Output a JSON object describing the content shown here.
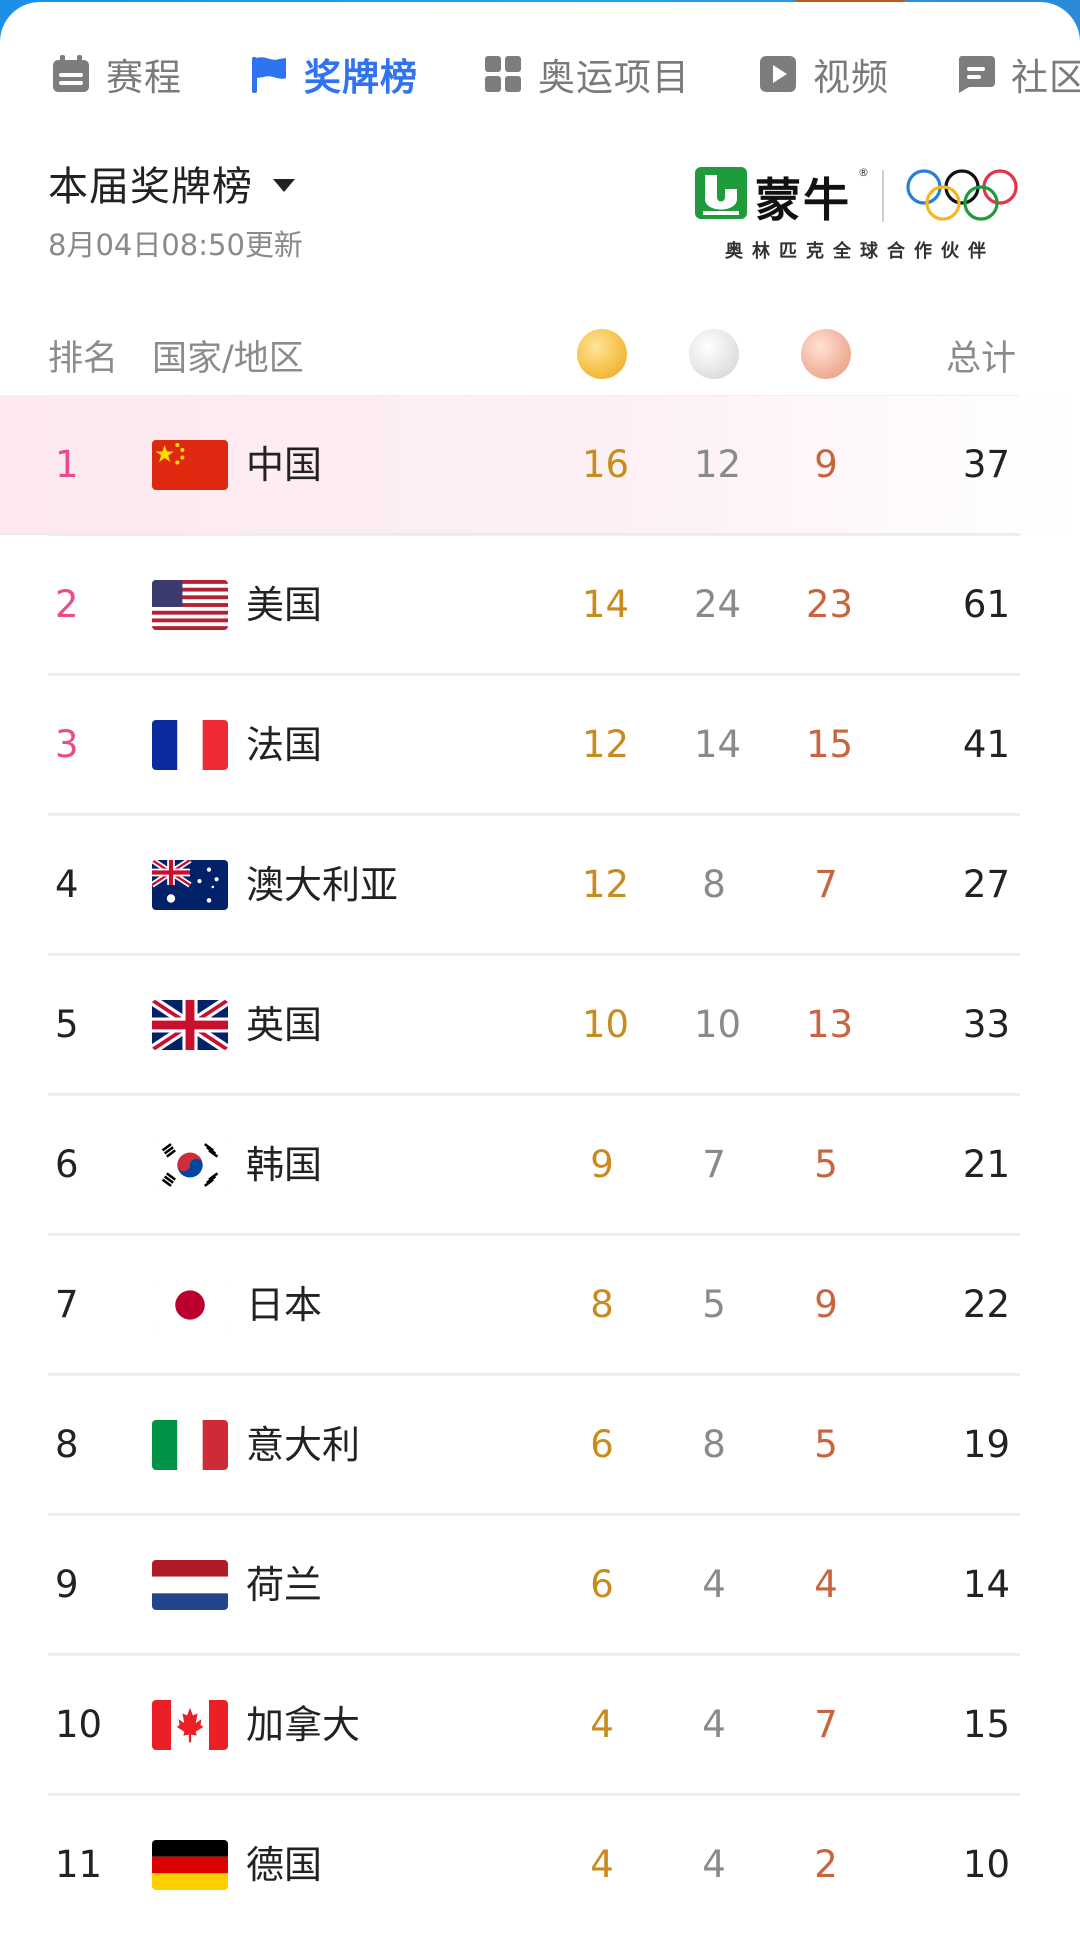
{
  "tabs": [
    {
      "label": "赛程",
      "icon": "calendar-icon",
      "active": false
    },
    {
      "label": "奖牌榜",
      "icon": "flag-icon",
      "active": true
    },
    {
      "label": "奥运项目",
      "icon": "grid-icon",
      "active": false
    },
    {
      "label": "视频",
      "icon": "play-icon",
      "active": false
    },
    {
      "label": "社区",
      "icon": "chat-icon",
      "active": false
    }
  ],
  "header": {
    "title": "本届奖牌榜",
    "updated": "8月04日08:50更新"
  },
  "sponsor": {
    "brand": "蒙牛",
    "tagline": "奥林匹克全球合作伙伴"
  },
  "table": {
    "col_rank": "排名",
    "col_country": "国家/地区",
    "col_total": "总计",
    "medal_icons": [
      "gold-medal-icon",
      "silver-medal-icon",
      "bronze-medal-icon"
    ],
    "rows": [
      {
        "rank": "1",
        "country": "中国",
        "flag": "china-flag-icon",
        "gold": "16",
        "silver": "12",
        "bronze": "9",
        "total": "37"
      },
      {
        "rank": "2",
        "country": "美国",
        "flag": "usa-flag-icon",
        "gold": "14",
        "silver": "24",
        "bronze": "23",
        "total": "61"
      },
      {
        "rank": "3",
        "country": "法国",
        "flag": "france-flag-icon",
        "gold": "12",
        "silver": "14",
        "bronze": "15",
        "total": "41"
      },
      {
        "rank": "4",
        "country": "澳大利亚",
        "flag": "australia-flag-icon",
        "gold": "12",
        "silver": "8",
        "bronze": "7",
        "total": "27"
      },
      {
        "rank": "5",
        "country": "英国",
        "flag": "uk-flag-icon",
        "gold": "10",
        "silver": "10",
        "bronze": "13",
        "total": "33"
      },
      {
        "rank": "6",
        "country": "韩国",
        "flag": "korea-flag-icon",
        "gold": "9",
        "silver": "7",
        "bronze": "5",
        "total": "21"
      },
      {
        "rank": "7",
        "country": "日本",
        "flag": "japan-flag-icon",
        "gold": "8",
        "silver": "5",
        "bronze": "9",
        "total": "22"
      },
      {
        "rank": "8",
        "country": "意大利",
        "flag": "italy-flag-icon",
        "gold": "6",
        "silver": "8",
        "bronze": "5",
        "total": "19"
      },
      {
        "rank": "9",
        "country": "荷兰",
        "flag": "netherlands-flag-icon",
        "gold": "6",
        "silver": "4",
        "bronze": "4",
        "total": "14"
      },
      {
        "rank": "10",
        "country": "加拿大",
        "flag": "canada-flag-icon",
        "gold": "4",
        "silver": "4",
        "bronze": "7",
        "total": "15"
      },
      {
        "rank": "11",
        "country": "德国",
        "flag": "germany-flag-icon",
        "gold": "4",
        "silver": "4",
        "bronze": "2",
        "total": "10"
      }
    ]
  },
  "colors": {
    "accent": "#2f73f0",
    "top_rank": "#e84c8a",
    "gold_text": "#c98a1e",
    "silver_text": "#8a8a8a",
    "bronze_text": "#c8643e"
  }
}
